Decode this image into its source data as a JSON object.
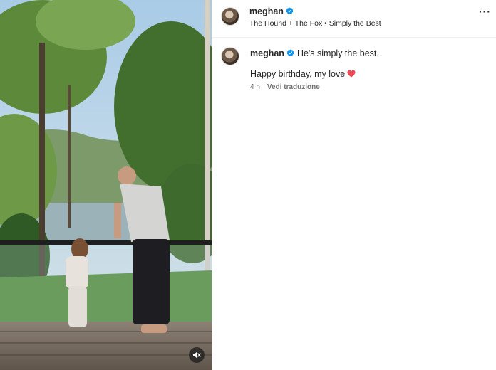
{
  "header": {
    "username": "meghan",
    "subtitle": "The Hound + The Fox • Simply the Best",
    "more_icon": "more-horizontal-icon"
  },
  "comment": {
    "username": "meghan",
    "caption": "He's simply the best.",
    "line2": "Happy birthday, my love",
    "emoji": "red-heart",
    "time": "4 h",
    "translate": "Vedi traduzione"
  },
  "media": {
    "audio_icon": "mute-icon"
  },
  "colors": {
    "verified": "#0095f6",
    "heart": "#ed4956",
    "text": "#262626",
    "secondary": "#737373"
  }
}
